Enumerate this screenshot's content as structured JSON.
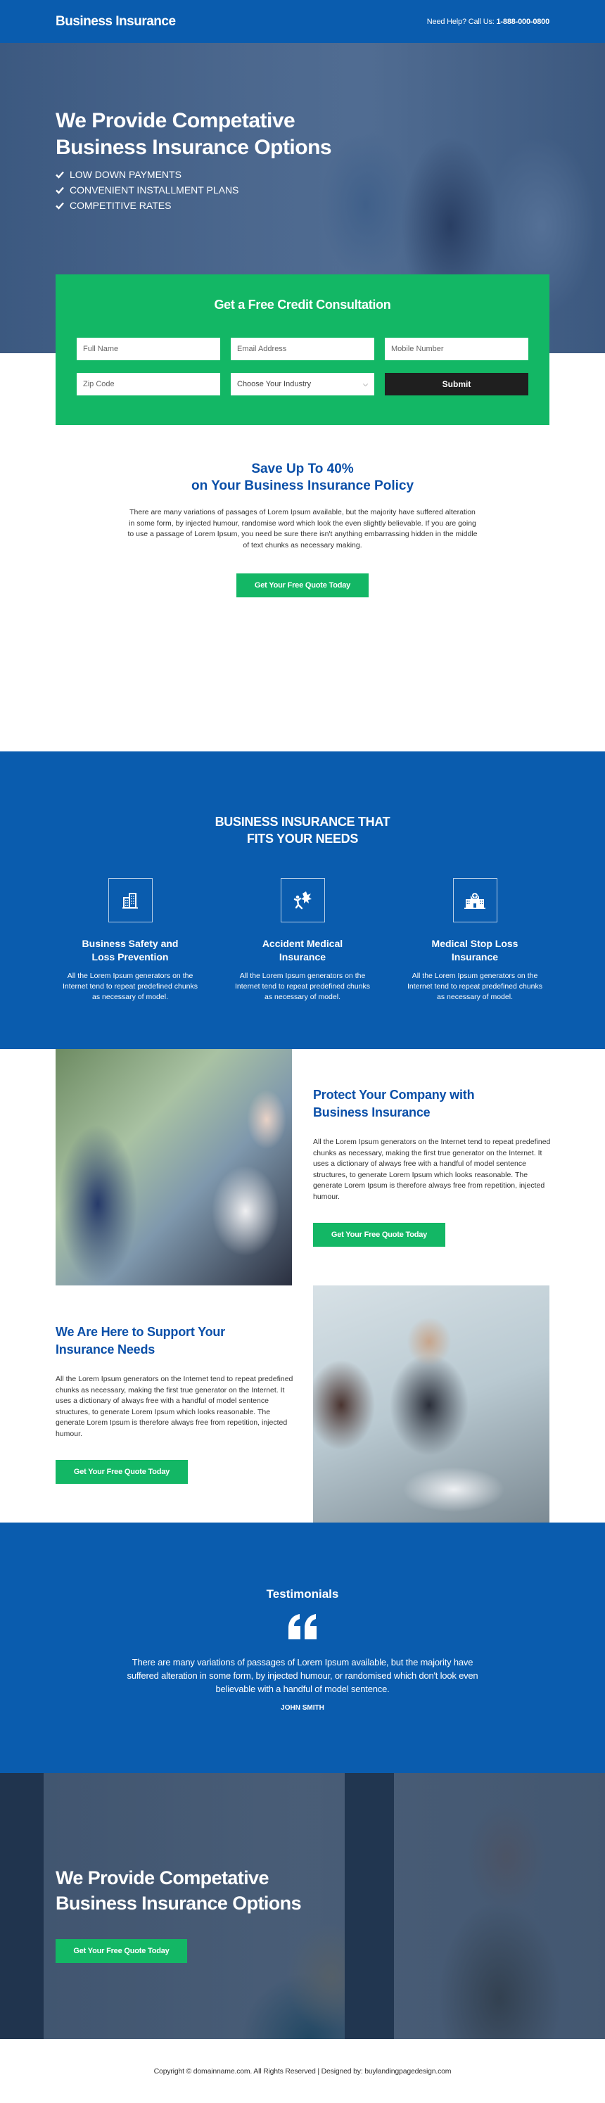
{
  "header": {
    "logo": "Business Insurance",
    "help_label": "Need Help? Call Us: ",
    "phone": "1-888-000-0800"
  },
  "hero": {
    "title_line1": "We Provide Competative",
    "title_line2": "Business Insurance Options",
    "features": [
      {
        "icon": "check-icon",
        "label": "LOW DOWN PAYMENTS"
      },
      {
        "icon": "check-icon",
        "label": "CONVENIENT INSTALLMENT PLANS"
      },
      {
        "icon": "check-icon",
        "label": "COMPETITIVE RATES"
      }
    ]
  },
  "form": {
    "title": "Get a Free Credit Consultation",
    "full_name_placeholder": "Full Name",
    "email_placeholder": "Email Address",
    "mobile_placeholder": "Mobile Number",
    "zip_placeholder": "Zip Code",
    "industry_selected": "Choose Your Industry",
    "submit_label": "Submit"
  },
  "save": {
    "title_line1": "Save Up To 40%",
    "title_line2": "on Your Business Insurance Policy",
    "body": "There are many variations of passages of Lorem Ipsum available, but the majority have suffered alteration in some form, by injected humour, randomise word which look the even slightly believable. If you are going to use a passage of Lorem Ipsum, you need be sure there isn't anything embarrassing hidden in the middle of text chunks as necessary making.",
    "cta": "Get Your Free Quote Today"
  },
  "features": {
    "title_line1": "BUSINESS INSURANCE THAT",
    "title_line2": "FITS YOUR NEEDS",
    "items": [
      {
        "icon": "office-buildings-icon",
        "title_line1": "Business Safety and",
        "title_line2": "Loss Prevention",
        "body": "All the Lorem Ipsum generators on the Internet tend to repeat predefined chunks as necessary of model."
      },
      {
        "icon": "accident-icon",
        "title_line1": "Accident Medical",
        "title_line2": "Insurance",
        "body": "All the Lorem Ipsum generators on the Internet tend to repeat predefined chunks as necessary of model."
      },
      {
        "icon": "hospital-icon",
        "title_line1": "Medical Stop Loss",
        "title_line2": "Insurance",
        "body": "All the Lorem Ipsum generators on the Internet tend to repeat predefined chunks as necessary of model."
      }
    ]
  },
  "protect": {
    "title_line1": "Protect Your Company with",
    "title_line2": "Business Insurance",
    "body": "All the Lorem Ipsum generators on the Internet tend to repeat predefined chunks as necessary, making the first true generator on the Internet. It uses a dictionary of always free with a handful of model sentence structures, to generate Lorem Ipsum which looks reasonable. The generate Lorem Ipsum is therefore always free from repetition, injected humour.",
    "cta": "Get Your Free Quote Today"
  },
  "support": {
    "title_line1": "We Are Here to Support Your",
    "title_line2": "Insurance Needs",
    "body": "All the Lorem Ipsum generators on the Internet tend to repeat predefined chunks as necessary, making the first true generator on the Internet. It uses a dictionary of always free with a handful of model sentence structures, to generate Lorem Ipsum which looks reasonable. The generate Lorem Ipsum is therefore always free from repetition, injected humour.",
    "cta": "Get Your Free Quote Today"
  },
  "testimonials": {
    "title": "Testimonials",
    "quote": "There are many variations of passages of Lorem Ipsum available, but the majority have suffered alteration in some form, by injected humour, or randomised which don't look even believable with a handful of model sentence.",
    "author": "JOHN SMITH"
  },
  "bottom_hero": {
    "title_line1": "We Provide Competative",
    "title_line2": "Business Insurance Options",
    "cta": "Get Your Free Quote Today"
  },
  "footer": {
    "copyright": "Copyright © domainname.com. All Rights Reserved | Designed by: buylandingpagedesign.com"
  },
  "colors": {
    "primary_blue": "#0a5cae",
    "heading_blue": "#0a4fa8",
    "accent_green": "#13b765",
    "submit_dark": "#1f1f1f"
  }
}
